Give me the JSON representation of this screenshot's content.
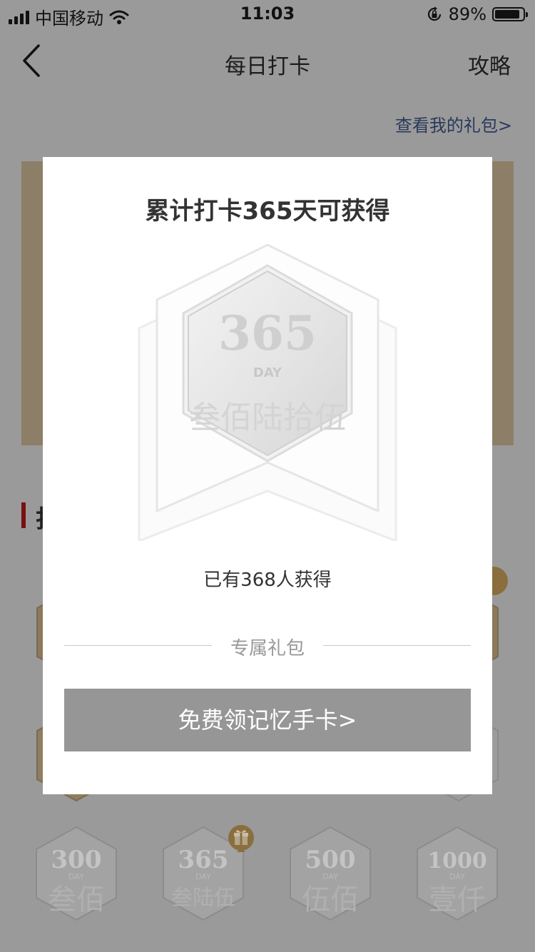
{
  "status_bar": {
    "carrier": "中国移动",
    "time": "11:03",
    "battery_percent": "89%",
    "battery_level": 0.89
  },
  "nav": {
    "title": "每日打卡",
    "right_label": "攻略",
    "gift_link": "查看我的礼包>"
  },
  "page": {
    "section_title_partial": "打",
    "bg_badges": [
      {
        "number": "300",
        "day": "DAY",
        "caption": "叁佰"
      },
      {
        "number": "365",
        "day": "DAY",
        "caption": "叁陆伍"
      },
      {
        "number": "500",
        "day": "DAY",
        "caption": "伍佰"
      },
      {
        "number": "1000",
        "day": "DAY",
        "caption": "壹仟"
      }
    ]
  },
  "modal": {
    "title": "累计打卡365天可获得",
    "badge": {
      "number": "365",
      "day": "DAY",
      "caption": "叁佰陆拾伍"
    },
    "holders_text": "已有368人获得",
    "divider_label": "专属礼包",
    "claim_button": "免费领记忆手卡>"
  }
}
